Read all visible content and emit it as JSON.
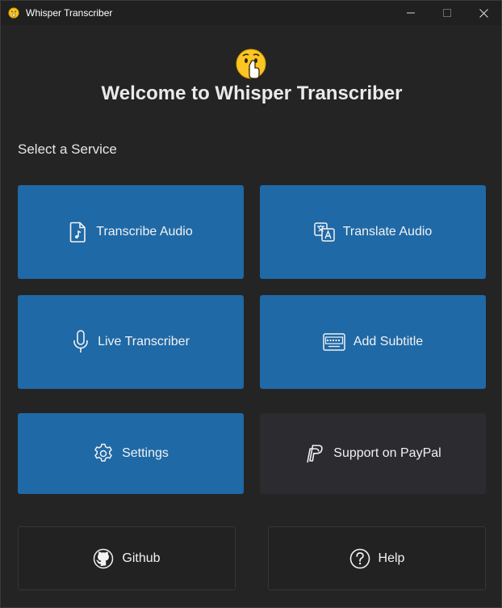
{
  "window": {
    "title": "Whisper Transcriber",
    "controls": {
      "minimize": "minimize",
      "maximize": "maximize",
      "close": "close"
    }
  },
  "header": {
    "title": "Welcome to Whisper Transcriber",
    "emoji_icon": "shushing-face-icon"
  },
  "section": {
    "label": "Select a Service"
  },
  "services": {
    "transcribe": {
      "label": "Transcribe Audio",
      "icon": "audio-file-icon"
    },
    "translate": {
      "label": "Translate Audio",
      "icon": "translate-icon"
    },
    "live": {
      "label": "Live Transcriber",
      "icon": "microphone-icon"
    },
    "subtitle": {
      "label": "Add Subtitle",
      "icon": "keyboard-subtitle-icon"
    },
    "settings": {
      "label": "Settings",
      "icon": "gear-icon"
    },
    "paypal": {
      "label": "Support on PayPal",
      "icon": "paypal-icon"
    }
  },
  "footer": {
    "github": {
      "label": "Github",
      "icon": "github-icon"
    },
    "help": {
      "label": "Help",
      "icon": "help-icon"
    }
  },
  "colors": {
    "background": "#242424",
    "primary_button": "#1f69a6",
    "secondary_button": "#2c2c30",
    "text": "#ffffff"
  }
}
